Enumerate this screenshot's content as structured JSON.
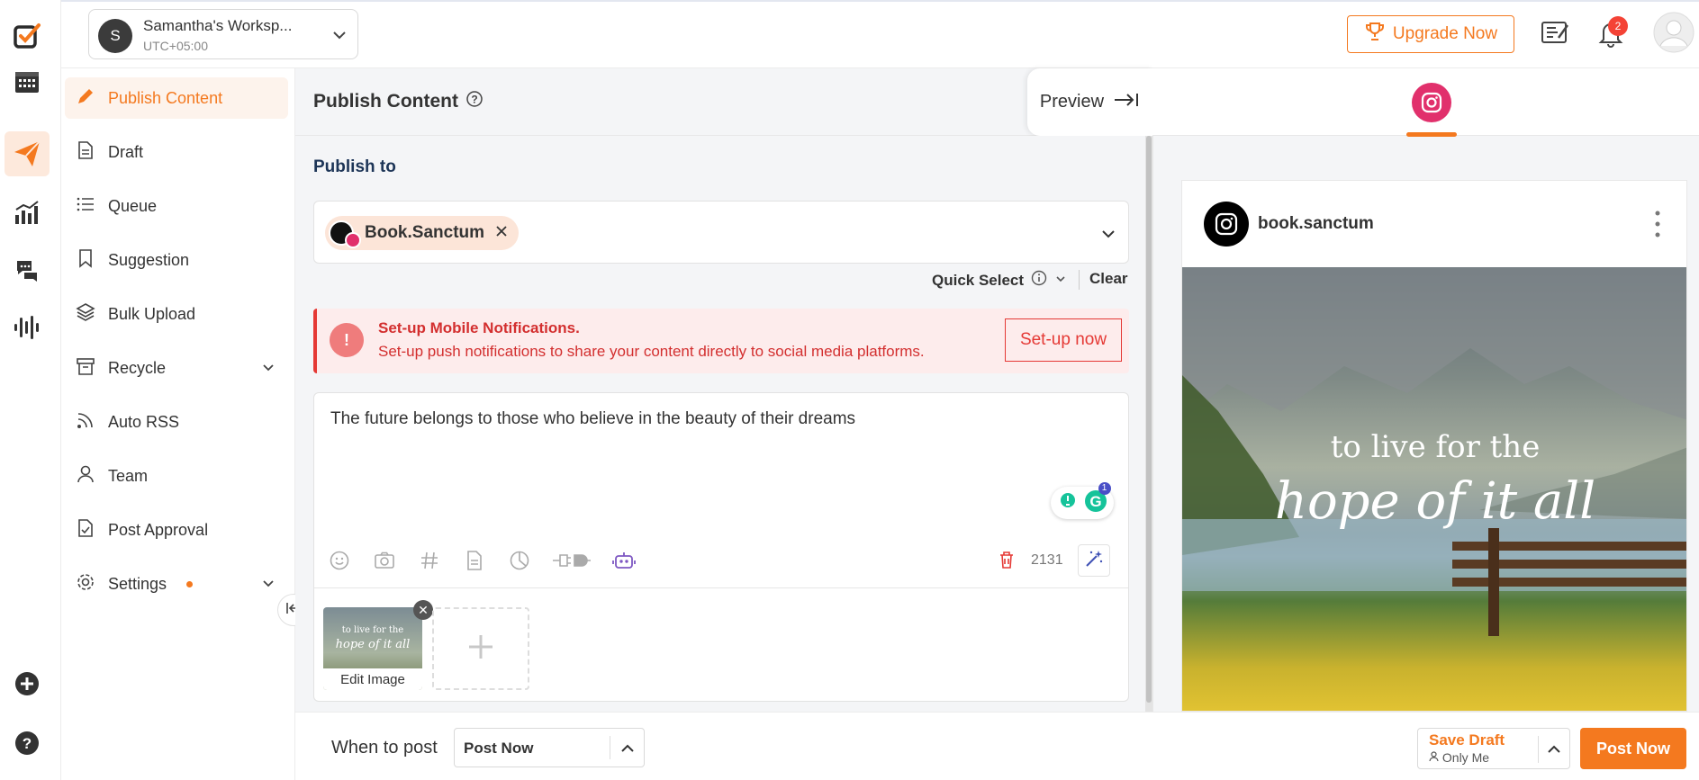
{
  "workspace": {
    "initial": "S",
    "name": "Samantha's Worksp...",
    "timezone": "UTC+05:00"
  },
  "topbar": {
    "upgrade_label": "Upgrade Now",
    "notification_count": "2"
  },
  "menu": {
    "items": [
      {
        "label": "Publish Content"
      },
      {
        "label": "Draft"
      },
      {
        "label": "Queue"
      },
      {
        "label": "Suggestion"
      },
      {
        "label": "Bulk Upload"
      },
      {
        "label": "Recycle"
      },
      {
        "label": "Auto RSS"
      },
      {
        "label": "Team"
      },
      {
        "label": "Post Approval"
      },
      {
        "label": "Settings"
      }
    ]
  },
  "editor": {
    "title": "Publish Content",
    "preview_label": "Preview",
    "publish_to_label": "Publish to",
    "account_chip": "Book.Sanctum",
    "quick_select_label": "Quick Select",
    "clear_label": "Clear",
    "notice": {
      "title": "Set-up Mobile Notifications.",
      "text": "Set-up push notifications to share your content directly to social media platforms.",
      "button": "Set-up now"
    },
    "post_text": "The future belongs to those who believe in the beauty of their dreams",
    "grammarly_count": "1",
    "char_count": "2131",
    "media": {
      "thumb_line1": "to live for the",
      "thumb_line2": "hope of it all",
      "edit_label": "Edit Image"
    }
  },
  "bottom": {
    "when_label": "When to post",
    "when_value": "Post Now",
    "save_draft_label": "Save Draft",
    "save_draft_sub": "Only Me",
    "post_now_label": "Post Now"
  },
  "preview": {
    "username": "book.sanctum",
    "quote_line1": "to live for the",
    "quote_line2": "hope of it all"
  },
  "colors": {
    "accent": "#f4791f",
    "alert": "#e53935",
    "instagram": "#e1306c"
  }
}
